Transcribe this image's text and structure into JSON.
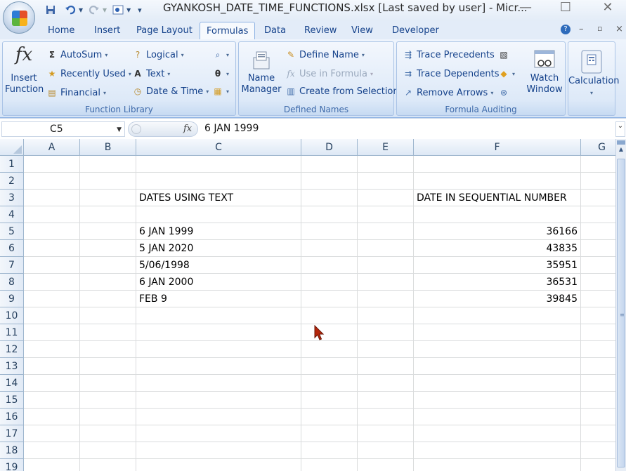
{
  "window": {
    "title": "GYANKOSH_DATE_TIME_FUNCTIONS.xlsx [Last saved by user]  -  Micr...",
    "controls": {
      "minimize": "—",
      "maximize": "☐",
      "close": "✕"
    }
  },
  "qat": {
    "dropdown": "▾",
    "customize": "₹"
  },
  "tabs": [
    "Home",
    "Insert",
    "Page Layout",
    "Formulas",
    "Data",
    "Review",
    "View",
    "Developer"
  ],
  "active_tab": "Formulas",
  "ribbon": {
    "function_library": {
      "label": "Function Library",
      "insert_function": "Insert\nFunction",
      "autosum": "AutoSum",
      "recently_used": "Recently Used",
      "financial": "Financial",
      "logical": "Logical",
      "text": "Text",
      "date_time": "Date & Time"
    },
    "defined_names": {
      "label": "Defined Names",
      "name_manager": "Name\nManager",
      "define_name": "Define Name",
      "use_in_formula": "Use in Formula",
      "create_from_selection": "Create from Selection"
    },
    "formula_auditing": {
      "label": "Formula Auditing",
      "trace_precedents": "Trace Precedents",
      "trace_dependents": "Trace Dependents",
      "remove_arrows": "Remove Arrows",
      "watch_window": "Watch\nWindow"
    },
    "calculation": {
      "label": "Calculation"
    }
  },
  "formula_bar": {
    "name_box": "C5",
    "fx": "fx",
    "formula": "6 JAN 1999"
  },
  "sheet": {
    "columns": [
      "A",
      "B",
      "C",
      "D",
      "E",
      "F",
      "G"
    ],
    "rows": [
      "1",
      "2",
      "3",
      "4",
      "5",
      "6",
      "7",
      "8",
      "9",
      "10",
      "11",
      "12",
      "13",
      "14",
      "15",
      "16",
      "17",
      "18",
      "19"
    ],
    "cells": {
      "C3": "DATES USING TEXT",
      "F3": "DATE IN SEQUENTIAL NUMBER",
      "C5": "6 JAN 1999",
      "F5": "36166",
      "C6": "5 JAN 2020",
      "F6": "43835",
      "C7": "5/06/1998",
      "F7": "35951",
      "C8": "6 JAN 2000",
      "F8": "36531",
      "C9": "FEB 9",
      "F9": "39845"
    }
  }
}
